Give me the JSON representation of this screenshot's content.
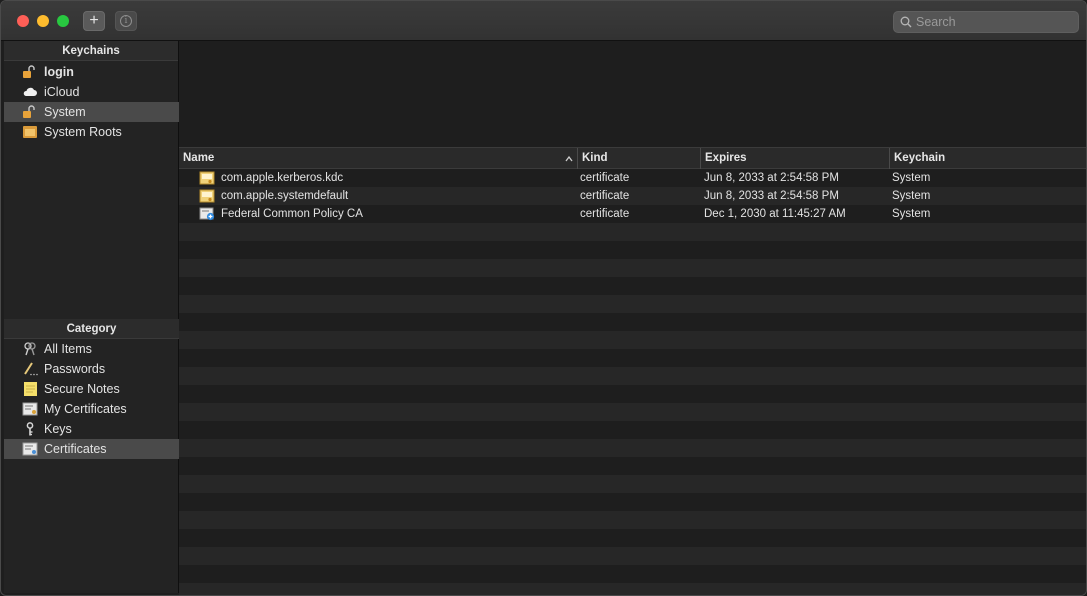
{
  "toolbar": {
    "add_button": "+",
    "info_button": "i",
    "search_placeholder": "Search"
  },
  "sidebar": {
    "keychains_header": "Keychains",
    "keychains": [
      {
        "label": "login",
        "icon": "lock-open-icon"
      },
      {
        "label": "iCloud",
        "icon": "cloud-icon"
      },
      {
        "label": "System",
        "icon": "lock-open-icon"
      },
      {
        "label": "System Roots",
        "icon": "cabinet-icon"
      }
    ],
    "category_header": "Category",
    "categories": [
      {
        "label": "All Items",
        "icon": "keys-icon"
      },
      {
        "label": "Passwords",
        "icon": "pencil-icon"
      },
      {
        "label": "Secure Notes",
        "icon": "note-icon"
      },
      {
        "label": "My Certificates",
        "icon": "certificate-icon"
      },
      {
        "label": "Keys",
        "icon": "key-icon"
      },
      {
        "label": "Certificates",
        "icon": "certificate-icon"
      }
    ]
  },
  "table": {
    "columns": {
      "name": "Name",
      "kind": "Kind",
      "expires": "Expires",
      "keychain": "Keychain"
    },
    "rows": [
      {
        "name": "com.apple.kerberos.kdc",
        "kind": "certificate",
        "expires": "Jun 8, 2033 at 2:54:58 PM",
        "keychain": "System",
        "icon": "certificate-icon"
      },
      {
        "name": "com.apple.systemdefault",
        "kind": "certificate",
        "expires": "Jun 8, 2033 at 2:54:58 PM",
        "keychain": "System",
        "icon": "certificate-icon"
      },
      {
        "name": "Federal Common Policy CA",
        "kind": "certificate",
        "expires": "Dec 1, 2030 at 11:45:27 AM",
        "keychain": "System",
        "icon": "root-certificate-icon"
      }
    ]
  },
  "colors": {
    "close": "#fe5f57",
    "minimize": "#febc2e",
    "maximize": "#28c840",
    "selection": "#4a4a4a"
  }
}
